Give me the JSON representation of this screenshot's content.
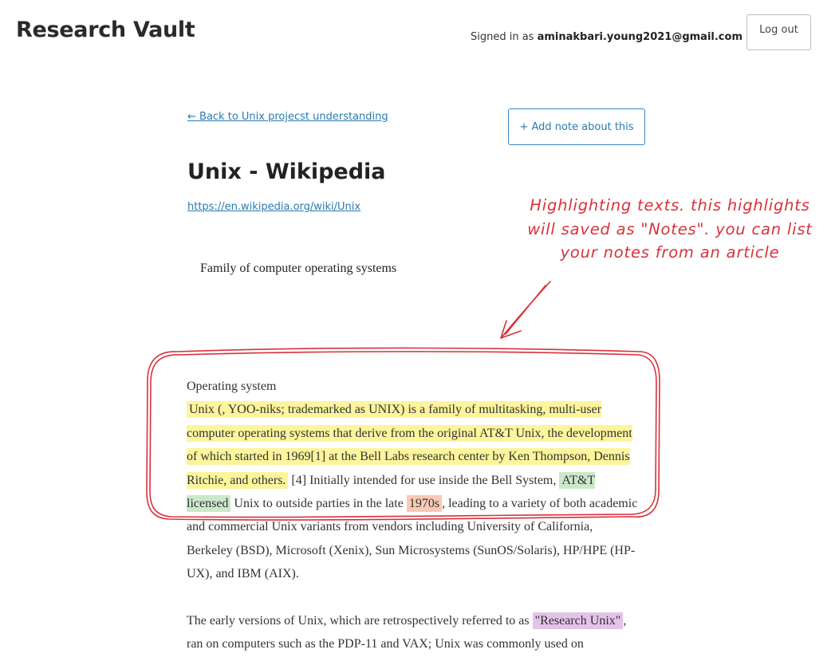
{
  "header": {
    "brand": "Research Vault",
    "signed_in_prefix": "Signed in as ",
    "user_email": "aminakbari.young2021@gmail.com",
    "logout_label": "Log out"
  },
  "article": {
    "back_link": "← Back to Unix projecst understanding",
    "add_note_label": "+ Add note about this",
    "title": "Unix - Wikipedia",
    "url": "https://en.wikipedia.org/wiki/Unix",
    "subtitle": "Family of computer operating systems",
    "p1": {
      "lead": "Operating system",
      "highlight_yellow": "Unix (, YOO-niks; trademarked as UNIX) is a family of multitasking, multi-user computer operating systems that derive from the original AT&T Unix, the development of which started in 1969[1] at the Bell Labs research center by Ken Thompson, Dennis Ritchie, and others.",
      "text_a": " [4] Initially intended for use inside the Bell System, ",
      "highlight_green": "AT&T licensed",
      "text_b": " Unix to outside parties in the late ",
      "highlight_salmon": "1970s",
      "text_c": ", leading to a variety of both academic and commercial Unix variants from vendors including University of California, Berkeley (BSD), Microsoft (Xenix), Sun Microsystems (SunOS/Solaris), HP/HPE (HP-UX), and IBM (AIX)."
    },
    "p2": {
      "text_a": "The early versions of Unix, which are retrospectively referred to as ",
      "highlight_purple": "\"Research Unix\"",
      "text_b": ", ran on computers such as the PDP-11 and VAX; Unix was commonly used on"
    }
  },
  "annotation": {
    "line1": "Highlighting texts. this highlights",
    "line2": "will saved as \"Notes\". you can list",
    "line3": "your notes from an article"
  },
  "colors": {
    "highlight_yellow": "#fdf59c",
    "highlight_green": "#cce8cc",
    "highlight_salmon": "#f8c9b6",
    "highlight_purple": "#e3c3e8",
    "annotation_red": "#d8323c",
    "link_blue": "#2a7ab0"
  }
}
